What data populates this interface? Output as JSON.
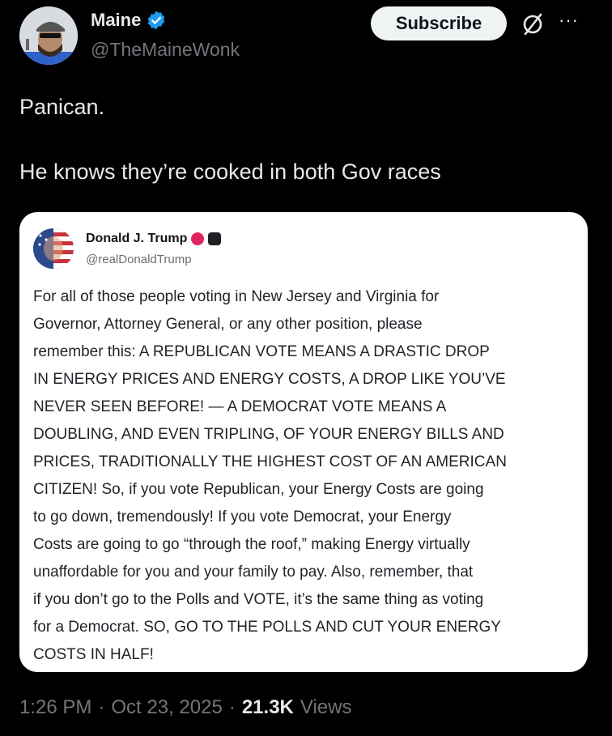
{
  "post": {
    "author": {
      "name": "Maine",
      "handle": "@TheMaineWonk",
      "verified": true,
      "avatar_icon": "avatar-man-with-cap"
    },
    "subscribe_label": "Subscribe",
    "more_label": "···",
    "text": "Panican.\n\nHe knows they’re cooked in both Gov races",
    "quoted": {
      "author_name": "Donald J. Trump",
      "handle": "@realDonaldTrump",
      "text": "For all of those people voting in New Jersey and Virginia for\nGovernor, Attorney General, or any other position, please\nremember this: A REPUBLICAN VOTE MEANS A DRASTIC DROP\nIN ENERGY PRICES AND ENERGY COSTS, A DROP LIKE YOU’VE\nNEVER SEEN BEFORE! — A DEMOCRAT VOTE MEANS A\nDOUBLING, AND EVEN TRIPLING, OF YOUR ENERGY BILLS AND\nPRICES, TRADITIONALLY THE HIGHEST COST OF AN AMERICAN\nCITIZEN! So, if you vote Republican, your Energy Costs are going\nto go down, tremendously! If you vote Democrat, your Energy\nCosts are going to go “through the roof,” making Energy virtually\nunaffordable for you and your family to pay. Also, remember, that\nif you don’t go to the Polls and VOTE, it’s the same thing as voting\nfor a Democrat. SO, GO TO THE POLLS AND CUT YOUR ENERGY\nCOSTS IN HALF!"
    },
    "meta": {
      "time": "1:26 PM",
      "date": "Oct 23, 2025",
      "views_count": "21.3K",
      "views_label": "Views"
    }
  },
  "colors": {
    "background": "#000000",
    "verified_blue": "#1d9bf0",
    "muted": "#71767b",
    "card": "#ffffff"
  }
}
